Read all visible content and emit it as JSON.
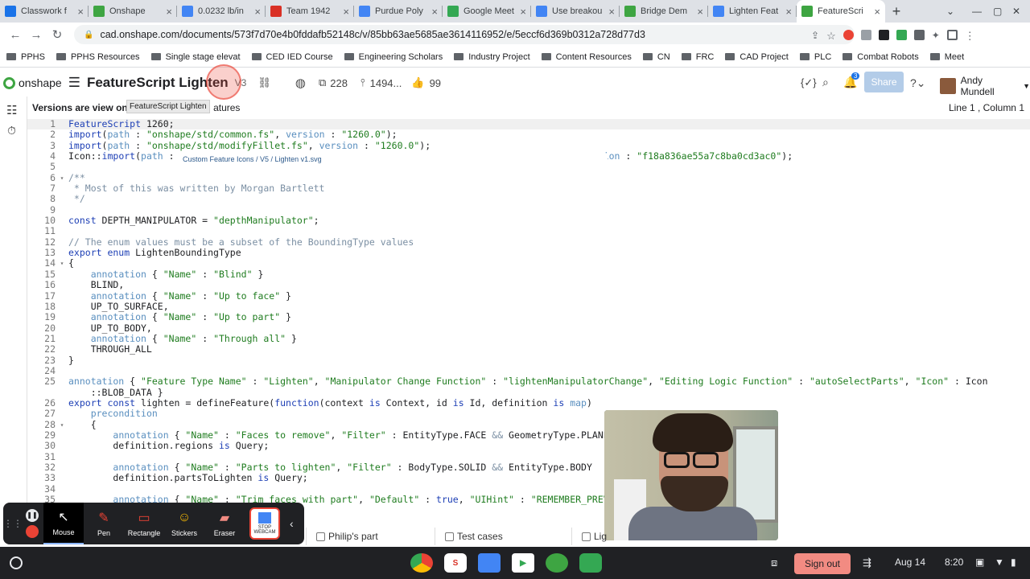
{
  "browser": {
    "tabs": [
      {
        "label": "Classwork f",
        "color": "#1a73e8"
      },
      {
        "label": "Onshape",
        "color": "#3ea542"
      },
      {
        "label": "0.0232 lb/in",
        "color": "#4285f4"
      },
      {
        "label": "Team 1942",
        "color": "#d93025"
      },
      {
        "label": "Purdue Poly",
        "color": "#4285f4"
      },
      {
        "label": "Google Meet",
        "color": "#34a853"
      },
      {
        "label": "Use breakou",
        "color": "#4285f4"
      },
      {
        "label": "Bridge Dem",
        "color": "#3ea542"
      },
      {
        "label": "Lighten Feat",
        "color": "#4285f4"
      },
      {
        "label": "FeatureScri",
        "color": "#3ea542"
      }
    ],
    "url": "cad.onshape.com/documents/573f7d70e4b0fddafb52148c/v/85bb63ae5685ae3614116952/e/5eccf6d369b0312a728d77d3",
    "bookmarks": [
      "PPHS",
      "PPHS Resources",
      "Single stage elevat",
      "CED IED Course",
      "Engineering Scholars",
      "Industry Project",
      "Content Resources",
      "CN",
      "FRC",
      "CAD Project",
      "PLC",
      "Combat Robots",
      "Meet"
    ]
  },
  "app": {
    "logo": "onshape",
    "title": "FeatureScript Lighten",
    "version": "V3",
    "copies": "228",
    "likes_count": "1494...",
    "likes": "99",
    "notif_badge": "3",
    "share_label": "Share",
    "user_name": "Andy Mundell",
    "notice": "Versions are view onl",
    "notice_tail": "atures",
    "tooltip": "FeatureScript Lighten",
    "cursor_pos": "Line 1 , Column 1",
    "icon_hint": "Custom Feature Icons / V5 / Lighten v1.svg"
  },
  "code_lines": [
    {
      "n": "1",
      "fold": "",
      "html": "<span class='k'>FeatureScript</span> 1260;",
      "hl": true
    },
    {
      "n": "2",
      "fold": "",
      "html": "<span class='k'>import</span>(<span class='a'>path</span> : <span class='s'>\"onshape/std/common.fs\"</span>, <span class='a'>version</span> : <span class='s'>\"1260.0\"</span>);"
    },
    {
      "n": "3",
      "fold": "",
      "html": "<span class='k'>import</span>(<span class='a'>path</span> : <span class='s'>\"onshape/std/modifyFillet.fs\"</span>, <span class='a'>version</span> : <span class='s'>\"1260.0\"</span>);"
    },
    {
      "n": "4",
      "fold": "",
      "html": "Icon::<span class='k'>import</span>(<span class='a'>path</span> :                                                                       , <span class='a'>version</span> : <span class='s'>\"f18a836ae55a7c8ba0cd3ac0\"</span>);"
    },
    {
      "n": "5",
      "fold": "",
      "html": ""
    },
    {
      "n": "6",
      "fold": "▾",
      "html": "<span class='c'>/**</span>"
    },
    {
      "n": "7",
      "fold": "",
      "html": "<span class='c'> * Most of this was written by Morgan Bartlett</span>"
    },
    {
      "n": "8",
      "fold": "",
      "html": "<span class='c'> */</span>"
    },
    {
      "n": "9",
      "fold": "",
      "html": ""
    },
    {
      "n": "10",
      "fold": "",
      "html": "<span class='k'>const</span> DEPTH_MANIPULATOR = <span class='s'>\"depthManipulator\"</span>;"
    },
    {
      "n": "11",
      "fold": "",
      "html": ""
    },
    {
      "n": "12",
      "fold": "",
      "html": "<span class='c'>// The enum values must be a subset of the BoundingType values</span>"
    },
    {
      "n": "13",
      "fold": "",
      "html": "<span class='k'>export enum</span> LightenBoundingType"
    },
    {
      "n": "14",
      "fold": "▾",
      "html": "{"
    },
    {
      "n": "15",
      "fold": "",
      "html": "    <span class='a'>annotation</span> { <span class='s'>\"Name\"</span> : <span class='s'>\"Blind\"</span> }"
    },
    {
      "n": "16",
      "fold": "",
      "html": "    BLIND,"
    },
    {
      "n": "17",
      "fold": "",
      "html": "    <span class='a'>annotation</span> { <span class='s'>\"Name\"</span> : <span class='s'>\"Up to face\"</span> }"
    },
    {
      "n": "18",
      "fold": "",
      "html": "    UP_TO_SURFACE,"
    },
    {
      "n": "19",
      "fold": "",
      "html": "    <span class='a'>annotation</span> { <span class='s'>\"Name\"</span> : <span class='s'>\"Up to part\"</span> }"
    },
    {
      "n": "20",
      "fold": "",
      "html": "    UP_TO_BODY,"
    },
    {
      "n": "21",
      "fold": "",
      "html": "    <span class='a'>annotation</span> { <span class='s'>\"Name\"</span> : <span class='s'>\"Through all\"</span> }"
    },
    {
      "n": "22",
      "fold": "",
      "html": "    THROUGH_ALL"
    },
    {
      "n": "23",
      "fold": "",
      "html": "}"
    },
    {
      "n": "24",
      "fold": "",
      "html": ""
    },
    {
      "n": "25",
      "fold": "",
      "html": "<span class='a'>annotation</span> { <span class='s'>\"Feature Type Name\"</span> : <span class='s'>\"Lighten\"</span>, <span class='s'>\"Manipulator Change Function\"</span> : <span class='s'>\"lightenManipulatorChange\"</span>, <span class='s'>\"Editing Logic Function\"</span> : <span class='s'>\"autoSelectParts\"</span>, <span class='s'>\"Icon\"</span> : Icon"
    },
    {
      "n": "",
      "fold": "",
      "html": "    ::BLOB_DATA }"
    },
    {
      "n": "26",
      "fold": "",
      "html": "<span class='k'>export const</span> lighten = defineFeature(<span class='k'>function</span>(context <span class='k'>is</span> Context, id <span class='k'>is</span> Id, definition <span class='k'>is</span> <span class='a'>map</span>)"
    },
    {
      "n": "27",
      "fold": "",
      "html": "    <span class='a'>precondition</span>"
    },
    {
      "n": "28",
      "fold": "▾",
      "html": "    {"
    },
    {
      "n": "29",
      "fold": "",
      "html": "        <span class='a'>annotation</span> { <span class='s'>\"Name\"</span> : <span class='s'>\"Faces to remove\"</span>, <span class='s'>\"Filter\"</span> : EntityType.FACE <span class='c'>&amp;&amp;</span> GeometryType.PLANE"
    },
    {
      "n": "30",
      "fold": "",
      "html": "        definition.regions <span class='k'>is</span> Query;"
    },
    {
      "n": "31",
      "fold": "",
      "html": ""
    },
    {
      "n": "32",
      "fold": "",
      "html": "        <span class='a'>annotation</span> { <span class='s'>\"Name\"</span> : <span class='s'>\"Parts to lighten\"</span>, <span class='s'>\"Filter\"</span> : BodyType.SOLID <span class='c'>&amp;&amp;</span> EntityType.BODY"
    },
    {
      "n": "33",
      "fold": "",
      "html": "        definition.partsToLighten <span class='k'>is</span> Query;"
    },
    {
      "n": "34",
      "fold": "",
      "html": ""
    },
    {
      "n": "35",
      "fold": "",
      "html": "        <span class='a'>annotation</span> { <span class='s'>\"Name\"</span> : <span class='s'>\"Trim faces with part\"</span>, <span class='s'>\"Default\"</span> : <span class='k'>true</span>, <span class='s'>\"UIHint\"</span> : <span class='s'>\"REMEMBER_PREVIOUS\"</span>"
    }
  ],
  "bottom_tabs": [
    "Philip's part",
    "Test cases",
    "Lig"
  ],
  "recorder": {
    "tools": [
      {
        "label": "Mouse",
        "glyph": "↖",
        "color": "#fff",
        "selected": true
      },
      {
        "label": "Pen",
        "glyph": "✎",
        "color": "#ea4335"
      },
      {
        "label": "Rectangle",
        "glyph": "▭",
        "color": "#ea4335"
      },
      {
        "label": "Stickers",
        "glyph": "☺",
        "color": "#fbbc04"
      },
      {
        "label": "Eraser",
        "glyph": "▰",
        "color": "#f28b82"
      }
    ],
    "stop_webcam": "STOP WEBCAM"
  },
  "shelf": {
    "sign_out": "Sign out",
    "date": "Aug 14",
    "time": "8:20"
  }
}
